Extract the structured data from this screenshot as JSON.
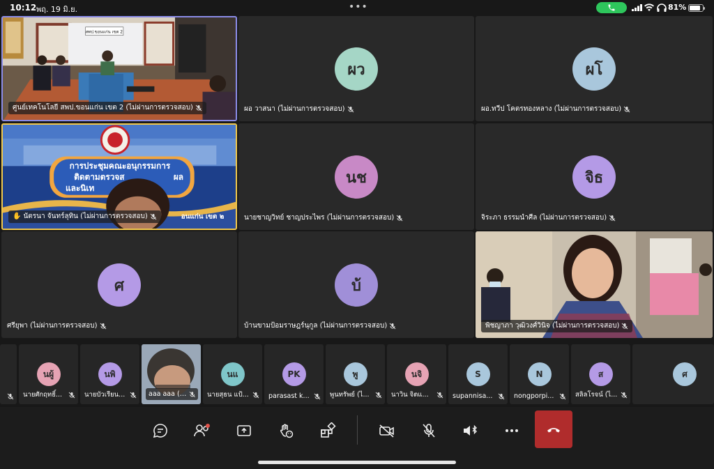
{
  "status": {
    "time": "10:12",
    "date": "พฤ. 19 มิ.ย.",
    "battery": "81%",
    "battery_level": 0.81
  },
  "stage": {
    "tiles": [
      {
        "name": "ศูนย์เทคโนโลยี สพป.ขอนแก่น เขต 2 (ไม่ผ่านการตรวจสอบ)",
        "type": "video"
      },
      {
        "name": "ผอ วาสนา (ไม่ผ่านการตรวจสอบ)",
        "initials": "ผว",
        "color": "#a5d6c6"
      },
      {
        "name": "ผอ.ทวีป โคตรทองหลาง (ไม่ผ่านการตรวจสอบ)",
        "initials": "ผโ",
        "color": "#a9c7dc"
      },
      {
        "name": "นัตรนา จันทร์ลุทิน (ไม่ผ่านการตรวจสอบ)",
        "type": "video"
      },
      {
        "name": "นายชาญวิทย์ ชาญประไพร (ไม่ผ่านการตรวจสอบ)",
        "initials": "นช",
        "color": "#c889c6"
      },
      {
        "name": "จิระภา ธรรมนำศีล (ไม่ผ่านการตรวจสอบ)",
        "initials": "จิธ",
        "color": "#b49ae6"
      },
      {
        "name": "ศรียุพา (ไม่ผ่านการตรวจสอบ)",
        "initials": "ศ",
        "color": "#b49ae6"
      },
      {
        "name": "บ้านขามป้อมราษฎร์นุกูล (ไม่ผ่านการตรวจสอบ)",
        "initials": "บ้",
        "color": "#a08fd8"
      },
      {
        "name": "พิชญาภา วุฒิวงศ์วินิจ (ไม่ผ่านการตรวจสอบ)",
        "type": "video"
      }
    ],
    "banner_line1": "การประชุมคณะอนุกรรมการ",
    "banner_line2": "ติดตามตรวจส",
    "banner_line2b": "ผล",
    "banner_line3": "และนิเท",
    "banner_line4": "อนแก่น เขต ๒",
    "room_sign": "สพป.ขอนแก่น เขต 2"
  },
  "strip": [
    {
      "name": "",
      "initials": "",
      "color": "#262626"
    },
    {
      "name": "นายศักฤทธิ์...",
      "initials": "นผู้",
      "color": "#e6a3b4"
    },
    {
      "name": "นายบัวเรียน...",
      "initials": "นพิ",
      "color": "#b49ae6"
    },
    {
      "name": "aaa aaa (ไ...",
      "initials": "",
      "color": "#262626",
      "video": true
    },
    {
      "name": "นายสุธน แป้...",
      "initials": "นแ",
      "color": "#7fc6c9"
    },
    {
      "name": "parasast k...",
      "initials": "PK",
      "color": "#b49ae6"
    },
    {
      "name": "พูนทรัพย์ (ไ...",
      "initials": "พู",
      "color": "#a9c7dc"
    },
    {
      "name": "นาวิน จิตแ...",
      "initials": "นจิ",
      "color": "#e6a3b4"
    },
    {
      "name": "supannisa...",
      "initials": "S",
      "color": "#a9c7dc"
    },
    {
      "name": "nongporpi...",
      "initials": "N",
      "color": "#a9c7dc"
    },
    {
      "name": "สลิลโรจน์ (ไ...",
      "initials": "ส",
      "color": "#b49ae6"
    },
    {
      "name": "",
      "initials": "ศ",
      "color": "#a9c7dc"
    }
  ]
}
